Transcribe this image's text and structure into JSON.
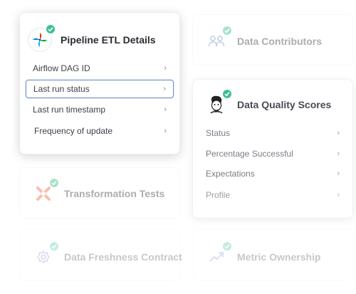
{
  "pipeline_card": {
    "title": "Pipeline ETL Details",
    "logo_icon": "airflow-pinwheel-icon",
    "items": [
      {
        "label": "Airflow DAG ID"
      },
      {
        "label": "Last run status",
        "selected": true
      },
      {
        "label": "Last run timestamp"
      },
      {
        "label": "Frequency of update"
      }
    ]
  },
  "contributors_card": {
    "title": "Data Contributors",
    "icon": "people-icon"
  },
  "quality_card": {
    "title": "Data Quality Scores",
    "logo_icon": "great-expectations-face-icon",
    "items": [
      {
        "label": "Status"
      },
      {
        "label": "Percentage Successful"
      },
      {
        "label": "Expectations"
      },
      {
        "label": "Profile"
      }
    ]
  },
  "transformation_card": {
    "title": "Transformation Tests",
    "icon": "dbt-x-icon"
  },
  "freshness_card": {
    "title": "Data Freshness Contract",
    "icon": "gear-icon"
  },
  "metric_card": {
    "title": "Metric Ownership",
    "icon": "trend-arrow-icon"
  },
  "chevron": "›",
  "colors": {
    "badge": "#3fbf96",
    "selected_border": "#6b8fc9",
    "dbt": "#f3704f"
  }
}
